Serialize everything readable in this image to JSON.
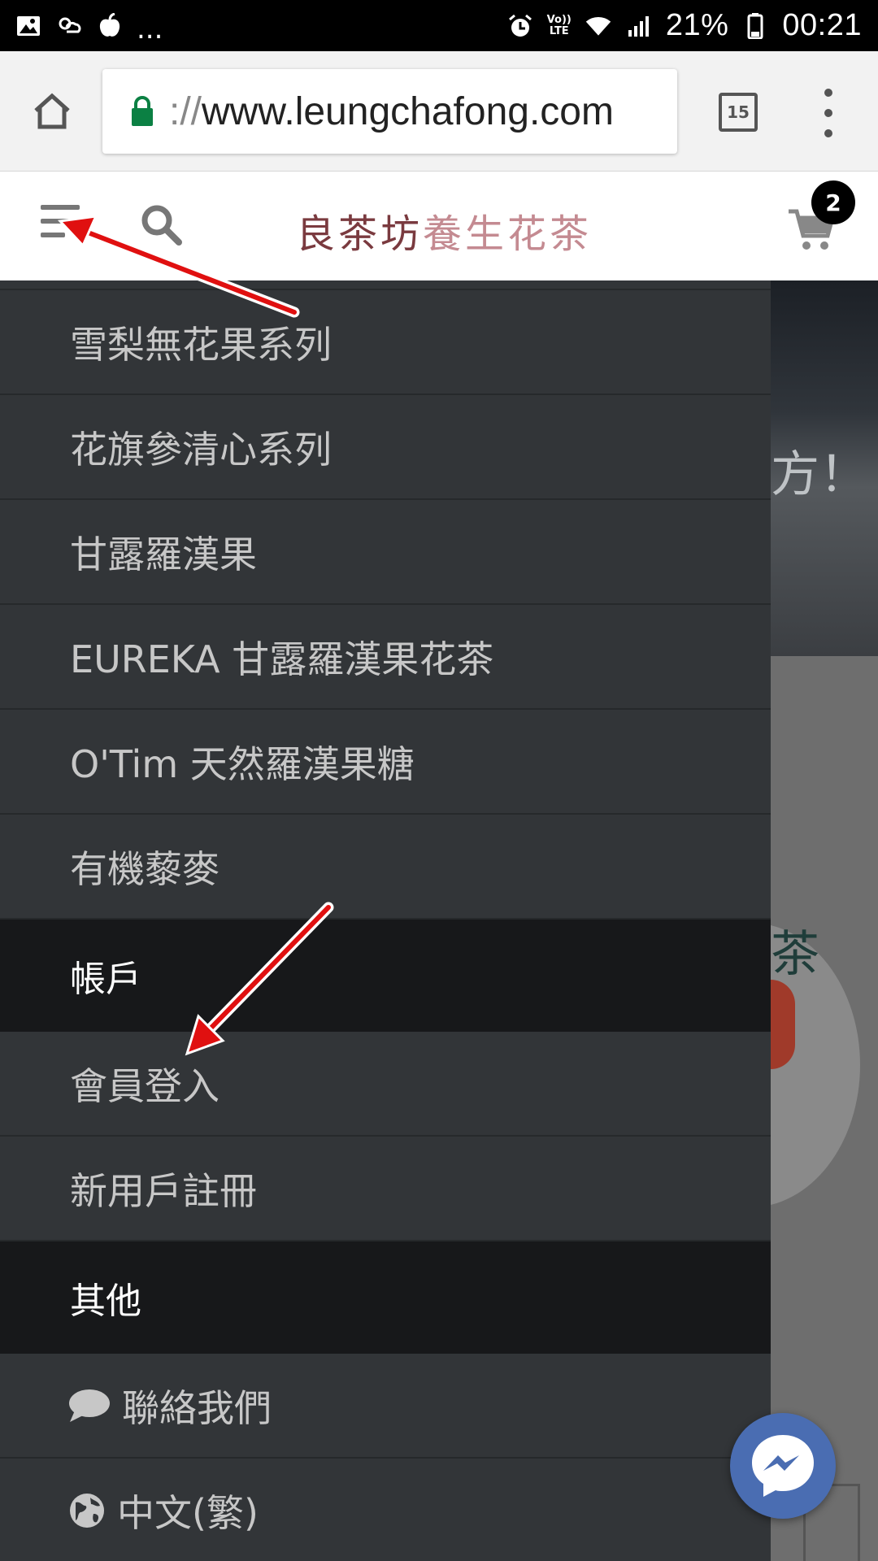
{
  "status_bar": {
    "battery_percent": "21%",
    "time": "00:21",
    "more_indicator": "...",
    "network_label_top": "Vo))",
    "network_label_bottom": "LTE"
  },
  "browser": {
    "url_scheme": "://",
    "url_host": "www.leungchafong.com",
    "tab_count": "15"
  },
  "site_header": {
    "logo_part1": "良茶坊",
    "logo_part2": "養生花茶",
    "cart_count": "2"
  },
  "background_page": {
    "hero_fragment": "方！",
    "char_fragment": "茶"
  },
  "drawer": {
    "product_items": [
      {
        "label": "雪梨無花果系列"
      },
      {
        "label": "花旗參清心系列"
      },
      {
        "label": "甘露羅漢果"
      },
      {
        "label": "EUREKA 甘露羅漢果花茶"
      },
      {
        "label": "O'Tim 天然羅漢果糖"
      },
      {
        "label": "有機藜麥"
      }
    ],
    "account_section": {
      "title": "帳戶",
      "items": [
        {
          "label": "會員登入"
        },
        {
          "label": "新用戶註冊"
        }
      ]
    },
    "other_section": {
      "title": "其他",
      "contact_label": "聯絡我們",
      "language_label": "中文(繁)"
    }
  },
  "colors": {
    "drawer_bg": "#323538",
    "section_bg": "#17181a",
    "arrow_red": "#e01010",
    "messenger_blue": "#4a6db2"
  }
}
